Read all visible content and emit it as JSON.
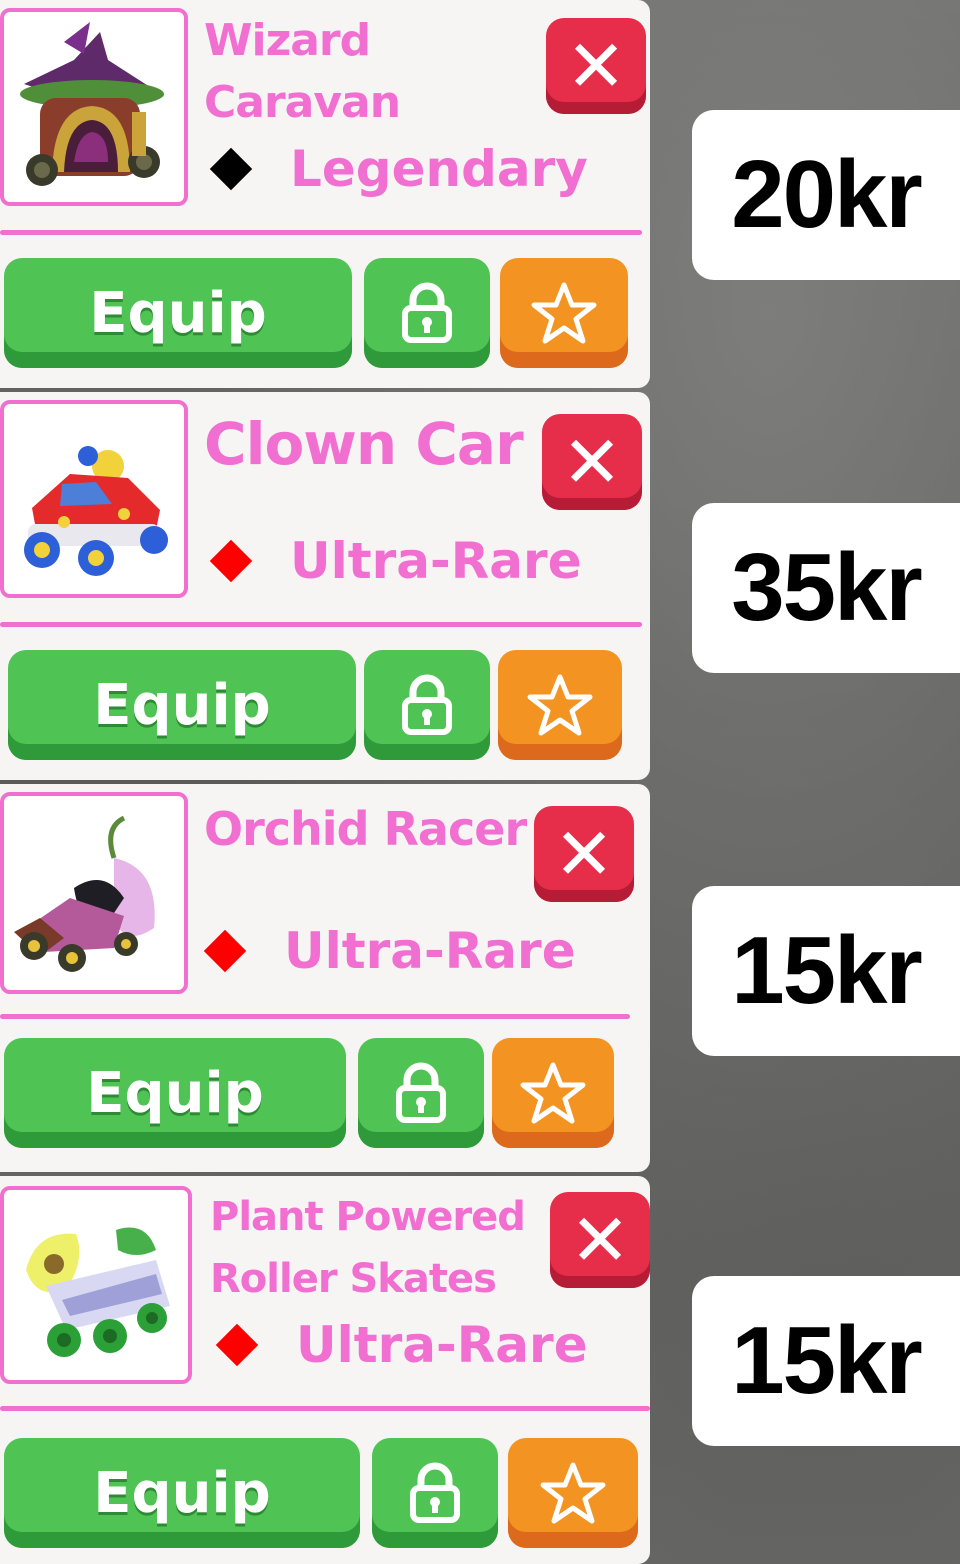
{
  "colors": {
    "name_pink": "#f06fd0",
    "legendary_diamond": "#000000",
    "ultra_rare_diamond": "#ff0000",
    "equip_green": "#4fc353",
    "favorite_orange": "#f39321",
    "remove_red": "#e62d4a"
  },
  "items": [
    {
      "name": "Wizard Caravan",
      "rarity": "Legendary",
      "equip_label": "Equip",
      "price": "20kr",
      "icon": "wizard-caravan-icon"
    },
    {
      "name": "Clown Car",
      "rarity": "Ultra-Rare",
      "equip_label": "Equip",
      "price": "35kr",
      "icon": "clown-car-icon"
    },
    {
      "name": "Orchid Racer",
      "rarity": "Ultra-Rare",
      "equip_label": "Equip",
      "price": "15kr",
      "icon": "orchid-racer-icon"
    },
    {
      "name": "Plant Powered Roller Skates",
      "rarity": "Ultra-Rare",
      "equip_label": "Equip",
      "price": "15kr",
      "icon": "plant-roller-skates-icon"
    }
  ],
  "buttons": {
    "remove_icon": "close-icon",
    "lock_icon": "lock-icon",
    "favorite_icon": "star-icon"
  }
}
